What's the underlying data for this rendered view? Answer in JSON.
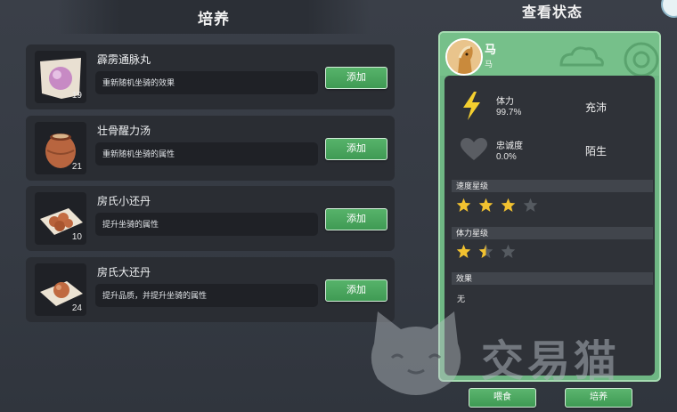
{
  "left_panel": {
    "title": "培养"
  },
  "items": [
    {
      "name": "霹雳通脉丸",
      "desc": "重新随机坐骑的效果",
      "count": "19",
      "add_label": "添加",
      "icon": "pink-pill-icon"
    },
    {
      "name": "壮骨醒力汤",
      "desc": "重新随机坐骑的属性",
      "count": "21",
      "add_label": "添加",
      "icon": "clay-pot-icon"
    },
    {
      "name": "房氏小还丹",
      "desc": "提升坐骑的属性",
      "count": "10",
      "add_label": "添加",
      "icon": "pellets-tray-icon"
    },
    {
      "name": "房氏大还丹",
      "desc": "提升品质，并提升坐骑的属性",
      "count": "24",
      "add_label": "添加",
      "icon": "single-pill-tray-icon"
    }
  ],
  "status": {
    "title": "查看状态",
    "horse_name": "马",
    "horse_sub": "马",
    "stamina": {
      "label": "体力",
      "value": "99.7%",
      "status": "充沛"
    },
    "loyalty": {
      "label": "忠诚度",
      "value": "0.0%",
      "status": "陌生"
    },
    "speed_stars": {
      "label": "速度星级",
      "rating": 3,
      "max": 4
    },
    "stamina_stars": {
      "label": "体力星级",
      "rating": 1.5,
      "max": 3
    },
    "effect": {
      "label": "效果",
      "value": "无"
    }
  },
  "buttons": {
    "feed": "喂食",
    "train": "培养"
  },
  "watermark": {
    "text": "交易猫"
  },
  "colors": {
    "accent_green": "#4aa85f",
    "panel_green": "#6fb784",
    "star_gold": "#f2c230"
  }
}
